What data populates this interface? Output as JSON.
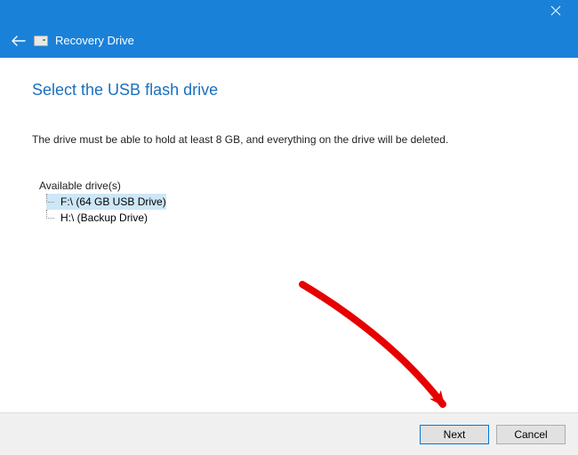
{
  "window": {
    "title": "Recovery Drive"
  },
  "page": {
    "heading": "Select the USB flash drive",
    "instruction": "The drive must be able to hold at least 8 GB, and everything on the drive will be deleted."
  },
  "drives": {
    "label": "Available drive(s)",
    "items": [
      {
        "text": "F:\\ (64 GB USB Drive)",
        "selected": true
      },
      {
        "text": "H:\\ (Backup Drive)",
        "selected": false
      }
    ]
  },
  "buttons": {
    "next": "Next",
    "cancel": "Cancel"
  }
}
